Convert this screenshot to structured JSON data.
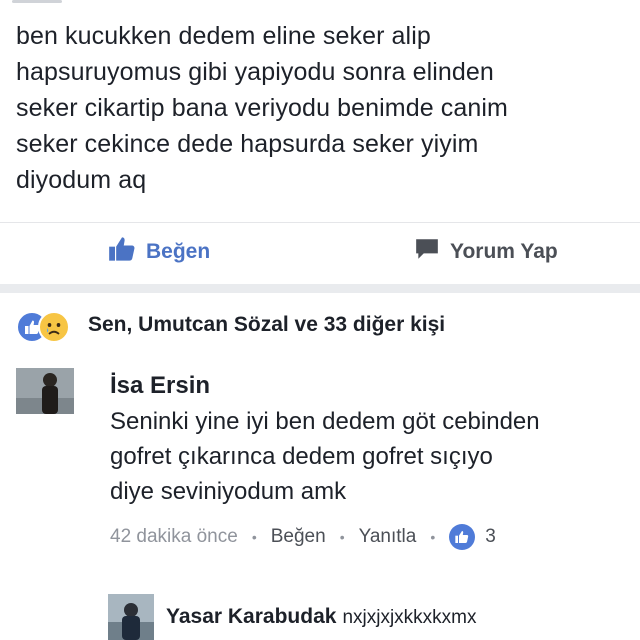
{
  "post": {
    "lines": [
      "ben kucukken dedem eline seker alip",
      "hapsuruyomus gibi yapiyodu sonra elinden",
      "seker cikartip bana veriyodu benimde canim",
      "seker cekince dede hapsurda seker yiyim",
      "diyodum aq"
    ]
  },
  "actions": {
    "like_label": "Beğen",
    "comment_label": "Yorum Yap"
  },
  "reactions": {
    "summary": "Sen, Umutcan Sözal ve 33 diğer kişi"
  },
  "comments": [
    {
      "author": "İsa Ersin",
      "lines": [
        "Seninki yine iyi ben dedem göt cebinden",
        "gofret çıkarınca dedem gofret sıçıyo",
        "diye seviniyodum amk"
      ],
      "time": "42 dakika önce",
      "like_label": "Beğen",
      "reply_label": "Yanıtla",
      "like_count": "3"
    },
    {
      "author": "Yasar Karabudak",
      "text": "nxjxjxjxkkxkxmx"
    }
  ],
  "colors": {
    "accent": "#4b73c4",
    "reaction_like": "#4f7bd8",
    "reaction_sad": "#f7c544",
    "meta_text": "#90949c"
  }
}
